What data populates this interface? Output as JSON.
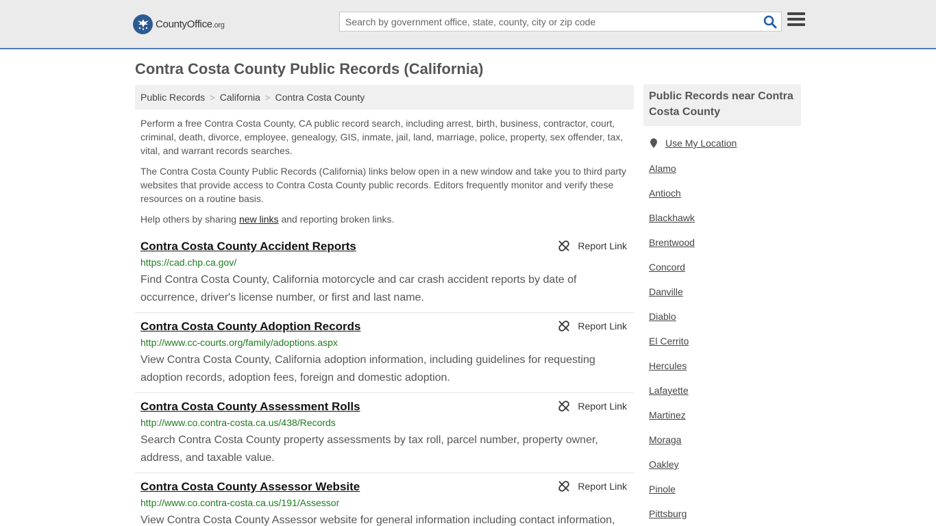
{
  "header": {
    "logo_brand": "CountyOffice",
    "logo_tld": ".org",
    "search_placeholder": "Search by government office, state, county, city or zip code"
  },
  "page": {
    "title": "Contra Costa County Public Records (California)"
  },
  "breadcrumb": [
    "Public Records",
    "California",
    "Contra Costa County"
  ],
  "intro": {
    "p1": "Perform a free Contra Costa County, CA public record search, including arrest, birth, business, contractor, court, criminal, death, divorce, employee, genealogy, GIS, inmate, jail, land, marriage, police, property, sex offender, tax, vital, and warrant records searches.",
    "p2": "The Contra Costa County Public Records (California) links below open in a new window and take you to third party websites that provide access to Contra Costa County public records. Editors frequently monitor and verify these resources on a routine basis.",
    "p3_before": "Help others by sharing ",
    "p3_link": "new links",
    "p3_after": " and reporting broken links."
  },
  "report_label": "Report Link",
  "records": [
    {
      "title": "Contra Costa County Accident Reports",
      "url": "https://cad.chp.ca.gov/",
      "desc": "Find Contra Costa County, California motorcycle and car crash accident reports by date of occurrence, driver's license number, or first and last name."
    },
    {
      "title": "Contra Costa County Adoption Records",
      "url": "http://www.cc-courts.org/family/adoptions.aspx",
      "desc": "View Contra Costa County, California adoption information, including guidelines for requesting adoption records, adoption fees, foreign and domestic adoption."
    },
    {
      "title": "Contra Costa County Assessment Rolls",
      "url": "http://www.co.contra-costa.ca.us/438/Records",
      "desc": "Search Contra Costa County property assessments by tax roll, parcel number, property owner, address, and taxable value."
    },
    {
      "title": "Contra Costa County Assessor Website",
      "url": "http://www.co.contra-costa.ca.us/191/Assessor",
      "desc": "View Contra Costa County Assessor website for general information including contact information,"
    }
  ],
  "sidebar": {
    "heading": "Public Records near Contra Costa County",
    "use_location": "Use My Location",
    "cities": [
      "Alamo",
      "Antioch",
      "Blackhawk",
      "Brentwood",
      "Concord",
      "Danville",
      "Diablo",
      "El Cerrito",
      "Hercules",
      "Lafayette",
      "Martinez",
      "Moraga",
      "Oakley",
      "Pinole",
      "Pittsburg"
    ]
  },
  "colors": {
    "header_bg": "#ebebeb",
    "header_border": "#4a7fb5",
    "brand_blue": "#2c5a92",
    "url_green": "#1e7a1e",
    "search_icon": "#1f5fa6"
  }
}
